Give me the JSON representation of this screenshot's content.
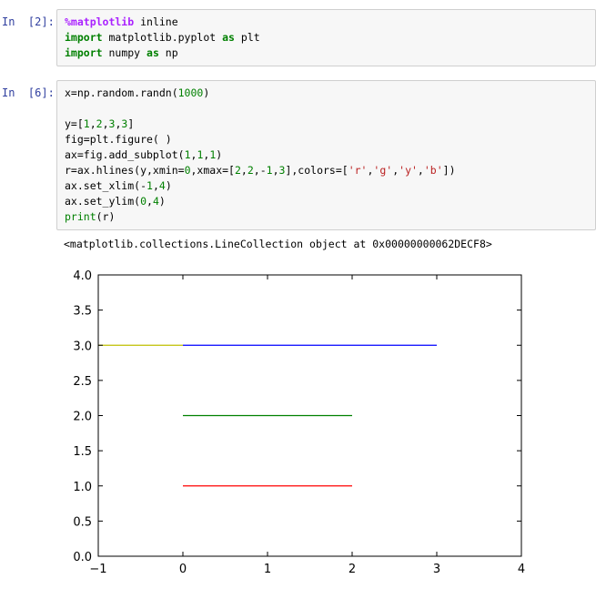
{
  "cells": [
    {
      "prompt": "In  [2]:",
      "lines": [
        [
          [
            "magic",
            "%matplotlib"
          ],
          [
            "plain",
            " inline"
          ]
        ],
        [
          [
            "kw",
            "import"
          ],
          [
            "plain",
            " matplotlib.pyplot "
          ],
          [
            "kw",
            "as"
          ],
          [
            "plain",
            " plt"
          ]
        ],
        [
          [
            "kw",
            "import"
          ],
          [
            "plain",
            " numpy "
          ],
          [
            "kw",
            "as"
          ],
          [
            "plain",
            " np"
          ]
        ]
      ]
    },
    {
      "prompt": "In  [6]:",
      "lines": [
        [
          [
            "plain",
            "x=np.random.randn("
          ],
          [
            "num",
            "1000"
          ],
          [
            "plain",
            ")"
          ]
        ],
        [],
        [
          [
            "plain",
            "y=["
          ],
          [
            "num",
            "1"
          ],
          [
            "plain",
            ","
          ],
          [
            "num",
            "2"
          ],
          [
            "plain",
            ","
          ],
          [
            "num",
            "3"
          ],
          [
            "plain",
            ","
          ],
          [
            "num",
            "3"
          ],
          [
            "plain",
            "]"
          ]
        ],
        [
          [
            "plain",
            "fig=plt.figure( )"
          ]
        ],
        [
          [
            "plain",
            "ax=fig.add_subplot("
          ],
          [
            "num",
            "1"
          ],
          [
            "plain",
            ","
          ],
          [
            "num",
            "1"
          ],
          [
            "plain",
            ","
          ],
          [
            "num",
            "1"
          ],
          [
            "plain",
            ")"
          ]
        ],
        [
          [
            "plain",
            "r=ax.hlines(y,xmin="
          ],
          [
            "num",
            "0"
          ],
          [
            "plain",
            ",xmax=["
          ],
          [
            "num",
            "2"
          ],
          [
            "plain",
            ","
          ],
          [
            "num",
            "2"
          ],
          [
            "plain",
            ",-"
          ],
          [
            "num",
            "1"
          ],
          [
            "plain",
            ","
          ],
          [
            "num",
            "3"
          ],
          [
            "plain",
            "],colors=["
          ],
          [
            "str",
            "'r'"
          ],
          [
            "plain",
            ","
          ],
          [
            "str",
            "'g'"
          ],
          [
            "plain",
            ","
          ],
          [
            "str",
            "'y'"
          ],
          [
            "plain",
            ","
          ],
          [
            "str",
            "'b'"
          ],
          [
            "plain",
            "])"
          ]
        ],
        [
          [
            "plain",
            "ax.set_xlim(-"
          ],
          [
            "num",
            "1"
          ],
          [
            "plain",
            ","
          ],
          [
            "num",
            "4"
          ],
          [
            "plain",
            ")"
          ]
        ],
        [
          [
            "plain",
            "ax.set_ylim("
          ],
          [
            "num",
            "0"
          ],
          [
            "plain",
            ","
          ],
          [
            "num",
            "4"
          ],
          [
            "plain",
            ")"
          ]
        ],
        [
          [
            "bi",
            "print"
          ],
          [
            "plain",
            "(r)"
          ]
        ]
      ]
    }
  ],
  "output_text": "<matplotlib.collections.LineCollection object at 0x00000000062DECF8>",
  "chart_data": {
    "type": "line",
    "xlim": [
      -1,
      4
    ],
    "ylim": [
      0,
      4
    ],
    "xticks": [
      -1,
      0,
      1,
      2,
      3,
      4
    ],
    "xtick_labels": [
      "−1",
      "0",
      "1",
      "2",
      "3",
      "4"
    ],
    "yticks": [
      0.0,
      0.5,
      1.0,
      1.5,
      2.0,
      2.5,
      3.0,
      3.5,
      4.0
    ],
    "ytick_labels": [
      "0.0",
      "0.5",
      "1.0",
      "1.5",
      "2.0",
      "2.5",
      "3.0",
      "3.5",
      "4.0"
    ],
    "grid": false,
    "series": [
      {
        "y": 1,
        "xmin": 0,
        "xmax": 2,
        "color": "#ff0000"
      },
      {
        "y": 2,
        "xmin": 0,
        "xmax": 2,
        "color": "#008000"
      },
      {
        "y": 3,
        "xmin": 0,
        "xmax": -1,
        "color": "#bfbf00"
      },
      {
        "y": 3,
        "xmin": 0,
        "xmax": 3,
        "color": "#0000ff"
      }
    ]
  }
}
